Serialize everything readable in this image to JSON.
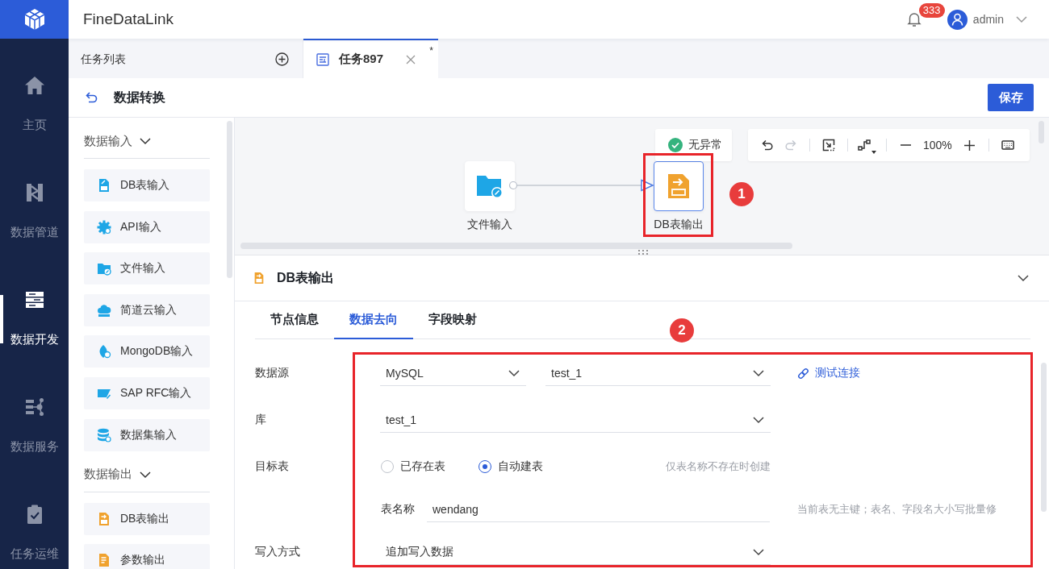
{
  "app": {
    "title": "FineDataLink"
  },
  "nav": {
    "items": [
      {
        "label": "主页",
        "kind": "home",
        "selected": false
      },
      {
        "label": "数据管道",
        "kind": "pipeline",
        "selected": false
      },
      {
        "label": "数据开发",
        "kind": "develop",
        "selected": true
      },
      {
        "label": "数据服务",
        "kind": "service",
        "selected": false
      },
      {
        "label": "任务运维",
        "kind": "operations",
        "selected": false
      }
    ]
  },
  "header": {
    "notification_count": "333",
    "user": "admin"
  },
  "tabs": [
    {
      "label": "任务列表",
      "kind": "list",
      "selected": false
    },
    {
      "label": "任务897",
      "kind": "task",
      "selected": true,
      "unsaved_mark": "*"
    }
  ],
  "page": {
    "title": "数据转换",
    "save_button": "保存"
  },
  "palette": {
    "sections": [
      {
        "title": "数据输入",
        "expanded": true,
        "items": [
          {
            "label": "DB表输入",
            "kind": "db_input"
          },
          {
            "label": "API输入",
            "kind": "api_input"
          },
          {
            "label": "文件输入",
            "kind": "file_input"
          },
          {
            "label": "简道云输入",
            "kind": "cloud_input"
          },
          {
            "label": "MongoDB输入",
            "kind": "mongodb_input"
          },
          {
            "label": "SAP RFC输入",
            "kind": "sap_input"
          },
          {
            "label": "数据集输入",
            "kind": "dataset_input"
          }
        ]
      },
      {
        "title": "数据输出",
        "expanded": true,
        "items": [
          {
            "label": "DB表输出",
            "kind": "db_output"
          },
          {
            "label": "参数输出",
            "kind": "param_output"
          }
        ]
      }
    ]
  },
  "canvas": {
    "status": "无异常",
    "toolbar": {
      "groups": [
        {
          "tools": [
            {
              "kind": "undo",
              "disabled": false
            },
            {
              "kind": "redo",
              "disabled": true
            }
          ]
        },
        {
          "tools": [
            {
              "kind": "fit",
              "disabled": false
            }
          ]
        },
        {
          "tools": [
            {
              "kind": "connector",
              "disabled": false
            }
          ]
        },
        {
          "tools": [
            {
              "kind": "zoom_out",
              "disabled": false
            },
            {
              "kind": "zoom_level",
              "text": "100%",
              "disabled": false
            },
            {
              "kind": "zoom_in",
              "disabled": false
            }
          ]
        },
        {
          "tools": [
            {
              "kind": "keyboard",
              "disabled": false
            }
          ]
        }
      ]
    },
    "nodes": [
      {
        "label": "文件输入",
        "kind": "file_input",
        "selected": false
      },
      {
        "label": "DB表输出",
        "kind": "db_output",
        "selected": true
      }
    ],
    "annotation": {
      "number": "1"
    }
  },
  "panel": {
    "title": "DB表输出",
    "tabs": [
      {
        "label": "节点信息",
        "selected": false
      },
      {
        "label": "数据去向",
        "selected": true
      },
      {
        "label": "字段映射",
        "selected": false
      }
    ],
    "annotation": {
      "number": "2"
    },
    "form": {
      "rows": [
        {
          "label": "数据源",
          "kind": "source",
          "selects": [
            {
              "value": "MySQL"
            },
            {
              "value": "test_1"
            }
          ],
          "link": "测试连接"
        },
        {
          "label": "库",
          "kind": "select",
          "value": "test_1"
        },
        {
          "label": "目标表",
          "kind": "radio",
          "options": [
            {
              "label": "已存在表",
              "selected": false
            },
            {
              "label": "自动建表",
              "selected": true
            }
          ],
          "hint": "仅表名称不存在时创建"
        },
        {
          "label": "表名称",
          "kind": "sub_input",
          "value": "wendang",
          "hint": "当前表无主键；表名、字段名大小写批量修"
        },
        {
          "label": "写入方式",
          "kind": "select",
          "value": "追加写入数据"
        }
      ]
    }
  }
}
